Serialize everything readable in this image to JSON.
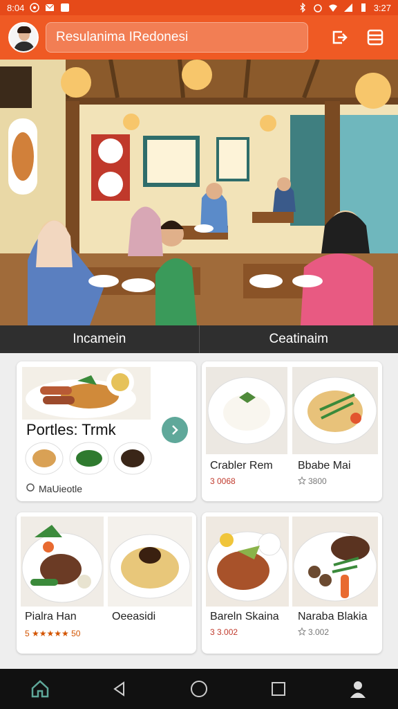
{
  "status_bar": {
    "time": "8:04",
    "clock_right": "3:27"
  },
  "header": {
    "search_value": "Resulanima IRedonesi"
  },
  "tabs": [
    "Incamein",
    "Ceatinaim"
  ],
  "cards": [
    {
      "title": "Portles: Trmk",
      "footer": "MaUieotle"
    },
    {
      "items": [
        {
          "name": "Crabler Rem",
          "price": "3 0068"
        },
        {
          "name": "Bbabe Mai",
          "price": "3800"
        }
      ]
    },
    {
      "items": [
        {
          "name": "Pialra Han",
          "rating": "5 ★★★★★ 50"
        },
        {
          "name": "Oeeasidi",
          "rating": ""
        }
      ]
    },
    {
      "items": [
        {
          "name": "Bareln Skaina",
          "price": "3 3.002"
        },
        {
          "name": "Naraba Blakia",
          "price": "3.002"
        }
      ]
    }
  ],
  "colors": {
    "primary": "#ef5a24",
    "status": "#e64a19",
    "accent": "#5fa89a"
  }
}
